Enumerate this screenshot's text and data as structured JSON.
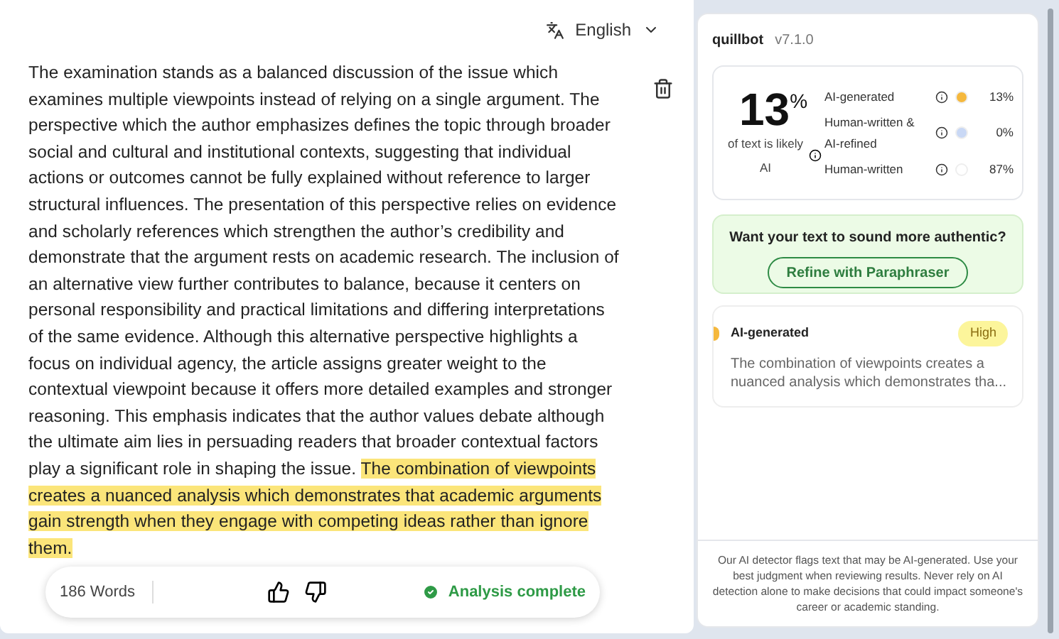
{
  "language": {
    "label": "English"
  },
  "editor": {
    "segments": [
      {
        "text": "The examination stands as a balanced discussion of the issue which examines multiple viewpoints instead of relying on a single argument. The perspective which the author emphasizes defines the topic through broader social and cultural and institutional contexts, suggesting that individual actions or outcomes cannot be fully explained without reference to larger structural influences. The presentation of this perspective relies on evidence and scholarly references which strengthen the author’s credibility and demonstrate that the argument rests on academic research. The inclusion of an alternative view further contributes to balance, because it centers on personal responsibility and practical limitations and differing interpretations of the same evidence. Although this alternative perspective highlights a focus on individual agency, the article assigns greater weight to the contextual viewpoint because it offers more detailed examples and stronger reasoning. This emphasis indicates that the author values debate although the ultimate aim lies in persuading readers that broader contextual factors play a significant role in shaping the issue. ",
        "highlighted": false
      },
      {
        "text": "The combination of viewpoints creates a nuanced analysis which demonstrates that academic arguments gain strength when they engage with competing ideas rather than ignore them.",
        "highlighted": true
      }
    ]
  },
  "footer": {
    "word_count": "186 Words",
    "status": "Analysis complete"
  },
  "panel": {
    "brand": "quillbot",
    "version": "v7.1.0",
    "score": {
      "value": "13",
      "unit": "%",
      "caption": "of text is likely AI"
    },
    "categories": [
      {
        "label": "AI-generated",
        "value": "13%",
        "color": "#f5b83d"
      },
      {
        "label": "Human-written & AI-refined",
        "value": "0%",
        "color": "#c9d8f5"
      },
      {
        "label": "Human-written",
        "value": "87%",
        "color": "#ffffff"
      }
    ],
    "cta": {
      "question": "Want your text to sound more authentic?",
      "button": "Refine with Paraphraser"
    },
    "results": [
      {
        "label": "AI-generated",
        "badge": "High",
        "color": "#f5b83d",
        "excerpt": "The combination of viewpoints creates a nuanced analysis which demonstrates tha..."
      }
    ],
    "disclaimer": "Our AI detector flags text that may be AI-generated. Use your best judgment when reviewing results. Never rely on AI detection alone to make decisions that could impact someone's career or academic standing."
  }
}
